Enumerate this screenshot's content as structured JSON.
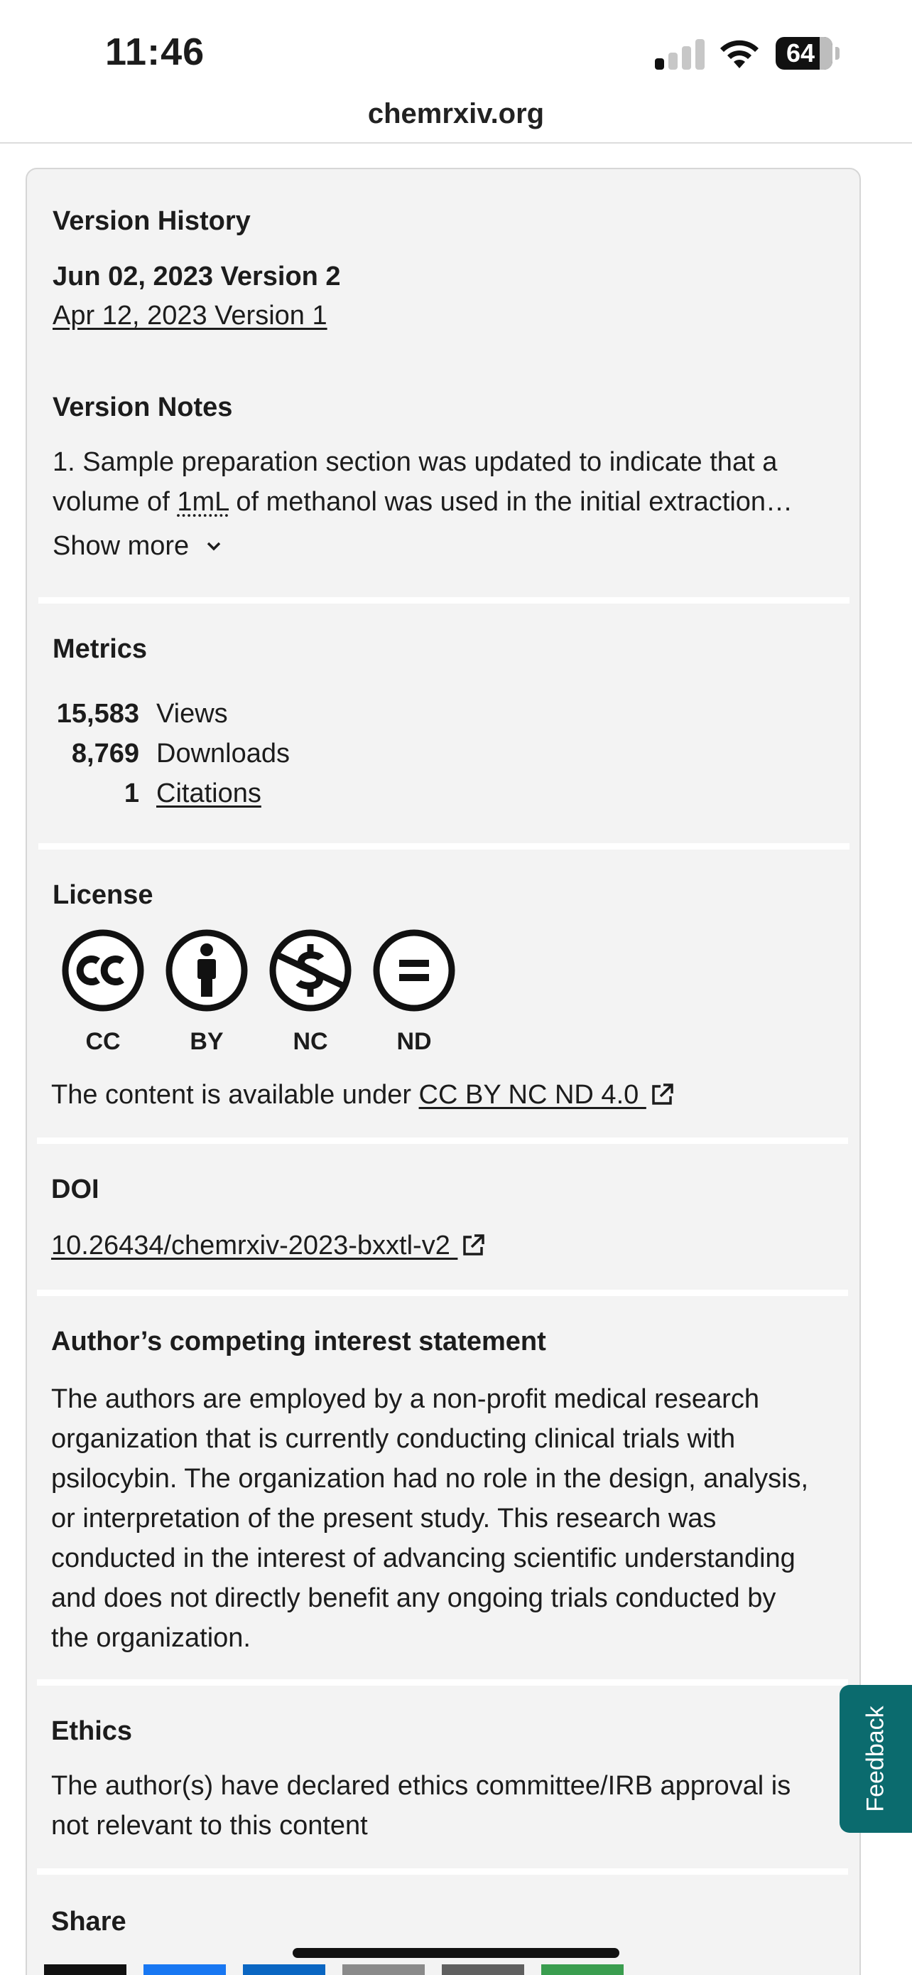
{
  "status_bar": {
    "time": "11:46",
    "battery": "64"
  },
  "browser": {
    "url": "chemrxiv.org"
  },
  "version_history": {
    "heading": "Version History",
    "current": "Jun 02, 2023 Version 2",
    "previous": "Apr 12, 2023 Version 1"
  },
  "version_notes": {
    "heading": "Version Notes",
    "line1": "1. Sample preparation section was updated to indicate that a",
    "line2_before": "volume of ",
    "line2_term": "1mL",
    "line2_after": " of methanol was used in the initial extraction…",
    "show_more": "Show more"
  },
  "metrics": {
    "heading": "Metrics",
    "rows": [
      {
        "value": "15,583",
        "label": "Views"
      },
      {
        "value": "8,769",
        "label": "Downloads"
      },
      {
        "value": "1",
        "label": "Citations"
      }
    ]
  },
  "license": {
    "heading": "License",
    "icons": [
      "CC",
      "BY",
      "NC",
      "ND"
    ],
    "text": "The content is available under ",
    "link": "CC BY NC ND 4.0 "
  },
  "doi": {
    "heading": "DOI",
    "link": "10.26434/chemrxiv-2023-bxxtl-v2 "
  },
  "competing_interest": {
    "heading": "Author’s competing interest statement",
    "lines": [
      "The authors are employed by a non-profit medical research",
      "organization that is currently conducting clinical trials with",
      "psilocybin. The organization had no role in the design, analysis,",
      "or interpretation of the present study. This research was",
      "conducted in the interest of advancing scientific understanding",
      "and does not directly benefit any ongoing trials conducted by",
      "the organization."
    ]
  },
  "ethics": {
    "heading": "Ethics",
    "lines": [
      "The author(s) have declared ethics committee/IRB approval is",
      "not relevant to this content"
    ]
  },
  "share": {
    "heading": "Share"
  },
  "feedback": {
    "label": "Feedback"
  },
  "colors": {
    "card_bg": "#f3f3f3",
    "feedback_bg": "#0b6b6e",
    "share_buttons": [
      "#111111",
      "#1877f2",
      "#0a66c2",
      "#8a8a8a",
      "#5f5f5f",
      "#3a9d4f"
    ]
  }
}
